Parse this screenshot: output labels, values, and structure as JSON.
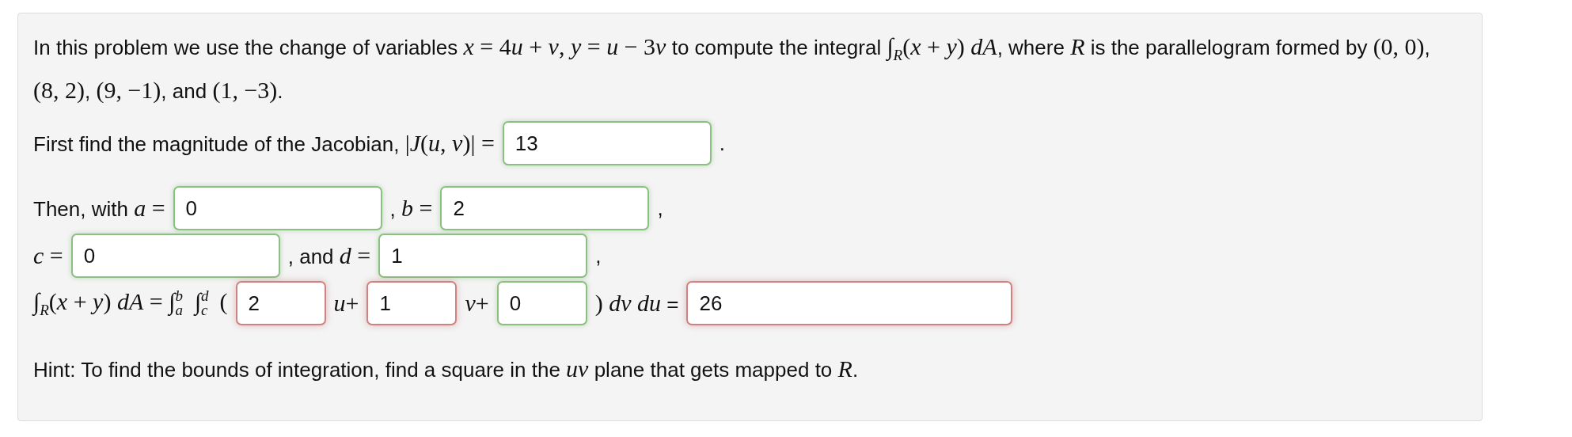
{
  "intro": [
    {
      "kind": "text",
      "t": "In this problem we use the change of variables "
    },
    {
      "kind": "var",
      "t": "x"
    },
    {
      "kind": "math",
      "t": " = 4"
    },
    {
      "kind": "var",
      "t": "u"
    },
    {
      "kind": "math",
      "t": " + "
    },
    {
      "kind": "var",
      "t": "v"
    },
    {
      "kind": "math",
      "t": ", "
    },
    {
      "kind": "var",
      "t": "y"
    },
    {
      "kind": "math",
      "t": " = "
    },
    {
      "kind": "var",
      "t": "u"
    },
    {
      "kind": "math",
      "t": " − 3"
    },
    {
      "kind": "var",
      "t": "v"
    },
    {
      "kind": "text",
      "t": " to compute the integral "
    },
    {
      "kind": "math",
      "t": "∫$_{R}$("
    },
    {
      "kind": "var",
      "t": "x"
    },
    {
      "kind": "math",
      "t": " + "
    },
    {
      "kind": "var",
      "t": "y"
    },
    {
      "kind": "math",
      "t": ") "
    },
    {
      "kind": "var",
      "t": "dA"
    },
    {
      "kind": "text",
      "t": ", where "
    },
    {
      "kind": "var",
      "t": "R"
    },
    {
      "kind": "text",
      "t": " is the parallelogram formed by "
    },
    {
      "kind": "math",
      "t": "(0, 0)"
    },
    {
      "kind": "text",
      "t": ", "
    },
    {
      "kind": "math",
      "t": "(8, 2)"
    },
    {
      "kind": "text",
      "t": ", "
    },
    {
      "kind": "math",
      "t": "(9, −1)"
    },
    {
      "kind": "text",
      "t": ", and "
    },
    {
      "kind": "math",
      "t": "(1, −3)"
    },
    {
      "kind": "text",
      "t": "."
    }
  ],
  "lines": [
    {
      "kind": "jacobian",
      "parts": [
        {
          "kind": "text",
          "segments": [
            {
              "kind": "text",
              "t": "First find the magnitude of the Jacobian, "
            },
            {
              "kind": "math",
              "t": "|"
            },
            {
              "kind": "var",
              "t": "J"
            },
            {
              "kind": "math",
              "t": "("
            },
            {
              "kind": "var",
              "t": "u"
            },
            {
              "kind": "math",
              "t": ", "
            },
            {
              "kind": "var",
              "t": "v"
            },
            {
              "kind": "math",
              "t": ")| ="
            }
          ]
        },
        {
          "kind": "field",
          "value": "13",
          "correct": true
        },
        {
          "kind": "text",
          "segments": [
            {
              "kind": "text",
              "t": "."
            }
          ]
        }
      ]
    },
    {
      "kind": "bounds",
      "parts": [
        {
          "kind": "text",
          "segments": [
            {
              "kind": "text",
              "t": "Then, with "
            },
            {
              "kind": "var",
              "t": "a"
            },
            {
              "kind": "math",
              "t": " ="
            }
          ]
        },
        {
          "kind": "field",
          "value": "0",
          "correct": true
        },
        {
          "kind": "text",
          "segments": [
            {
              "kind": "text",
              "t": ", "
            },
            {
              "kind": "var",
              "t": "b"
            },
            {
              "kind": "math",
              "t": " ="
            }
          ]
        },
        {
          "kind": "field",
          "value": "2",
          "correct": true
        },
        {
          "kind": "text",
          "segments": [
            {
              "kind": "text",
              "t": ","
            }
          ]
        }
      ]
    },
    {
      "kind": "bounds",
      "parts": [
        {
          "kind": "text",
          "segments": [
            {
              "kind": "var",
              "t": "c"
            },
            {
              "kind": "math",
              "t": " ="
            }
          ]
        },
        {
          "kind": "field",
          "value": "0",
          "correct": true
        },
        {
          "kind": "text",
          "segments": [
            {
              "kind": "text",
              "t": ", and "
            },
            {
              "kind": "var",
              "t": "d"
            },
            {
              "kind": "math",
              "t": " ="
            }
          ]
        },
        {
          "kind": "field",
          "value": "1",
          "correct": true
        },
        {
          "kind": "text",
          "segments": [
            {
              "kind": "text",
              "t": ","
            }
          ]
        }
      ]
    },
    {
      "kind": "integral",
      "parts": [
        {
          "kind": "text",
          "segments": [
            {
              "kind": "math",
              "t": "∫$_{R}$("
            },
            {
              "kind": "var",
              "t": "x"
            },
            {
              "kind": "math",
              "t": " + "
            },
            {
              "kind": "var",
              "t": "y"
            },
            {
              "kind": "math",
              "t": ") "
            },
            {
              "kind": "var",
              "t": "dA"
            },
            {
              "kind": "math",
              "t": " = ∫$^{b}$$_{a}$  ∫$^{d}$$_{c}$  ("
            }
          ]
        },
        {
          "kind": "field",
          "value": "2",
          "correct": false
        },
        {
          "kind": "text",
          "segments": [
            {
              "kind": "var",
              "t": "u"
            },
            {
              "kind": "math",
              "t": "+"
            }
          ]
        },
        {
          "kind": "field",
          "value": "1",
          "correct": false
        },
        {
          "kind": "text",
          "segments": [
            {
              "kind": "var",
              "t": "v"
            },
            {
              "kind": "math",
              "t": "+"
            }
          ]
        },
        {
          "kind": "field",
          "value": "0",
          "correct": true
        },
        {
          "kind": "text",
          "segments": [
            {
              "kind": "math",
              "t": ") "
            },
            {
              "kind": "var",
              "t": "dv du"
            },
            {
              "kind": "text",
              "t": " ="
            }
          ]
        },
        {
          "kind": "field",
          "value": "26",
          "correct": false
        }
      ]
    }
  ],
  "hint": [
    {
      "kind": "text",
      "t": "Hint: To find the bounds of integration, find a square in the "
    },
    {
      "kind": "var",
      "t": "uv"
    },
    {
      "kind": "text",
      "t": " plane that gets mapped to "
    },
    {
      "kind": "var",
      "t": "R"
    },
    {
      "kind": "text",
      "t": "."
    }
  ]
}
